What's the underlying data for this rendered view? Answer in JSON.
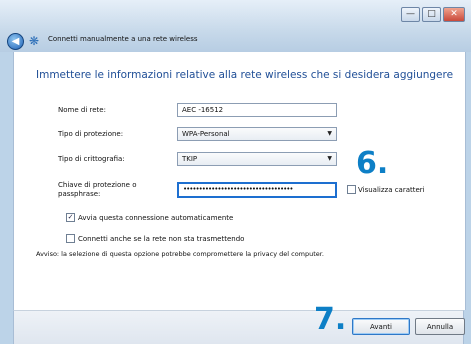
{
  "window": {
    "title": "Connetti manualmente a una rete wireless",
    "minimize_glyph": "—",
    "maximize_glyph": "□",
    "close_glyph": "✕"
  },
  "main": {
    "heading": "Immettere le informazioni relative alla rete wireless che si desidera aggiungere",
    "network_name_label": "Nome di rete:",
    "network_name_value": "AEC -16512",
    "security_type_label": "Tipo di protezione:",
    "security_type_value": "WPA-Personal",
    "encryption_type_label": "Tipo di crittografia:",
    "encryption_type_value": "TKIP",
    "key_label": "Chiave di protezione o passphrase:",
    "key_value": "•••••••••••••••••••••••••••••••••••",
    "show_chars_label": "Visualizza caratteri",
    "show_chars_checked": false,
    "auto_connect_label": "Avvia questa connessione automaticamente",
    "auto_connect_checked": true,
    "connect_hidden_label": "Connetti anche se la rete non sta trasmettendo",
    "connect_hidden_checked": false,
    "warning": "Avviso: la selezione di questa opzione potrebbe compromettere la privacy del computer."
  },
  "footer": {
    "next_label": "Avanti",
    "cancel_label": "Annulla"
  },
  "annotations": {
    "step6": "6.",
    "step7": "7."
  },
  "colors": {
    "heading": "#1f4e96",
    "step_numbers": "#0d7fc6",
    "focus_border": "#1d6fd0"
  },
  "icons": {
    "back": "back-arrow-icon",
    "network": "wireless-network-icon",
    "dropdown": "chevron-down-icon",
    "check": "checkmark-icon"
  }
}
